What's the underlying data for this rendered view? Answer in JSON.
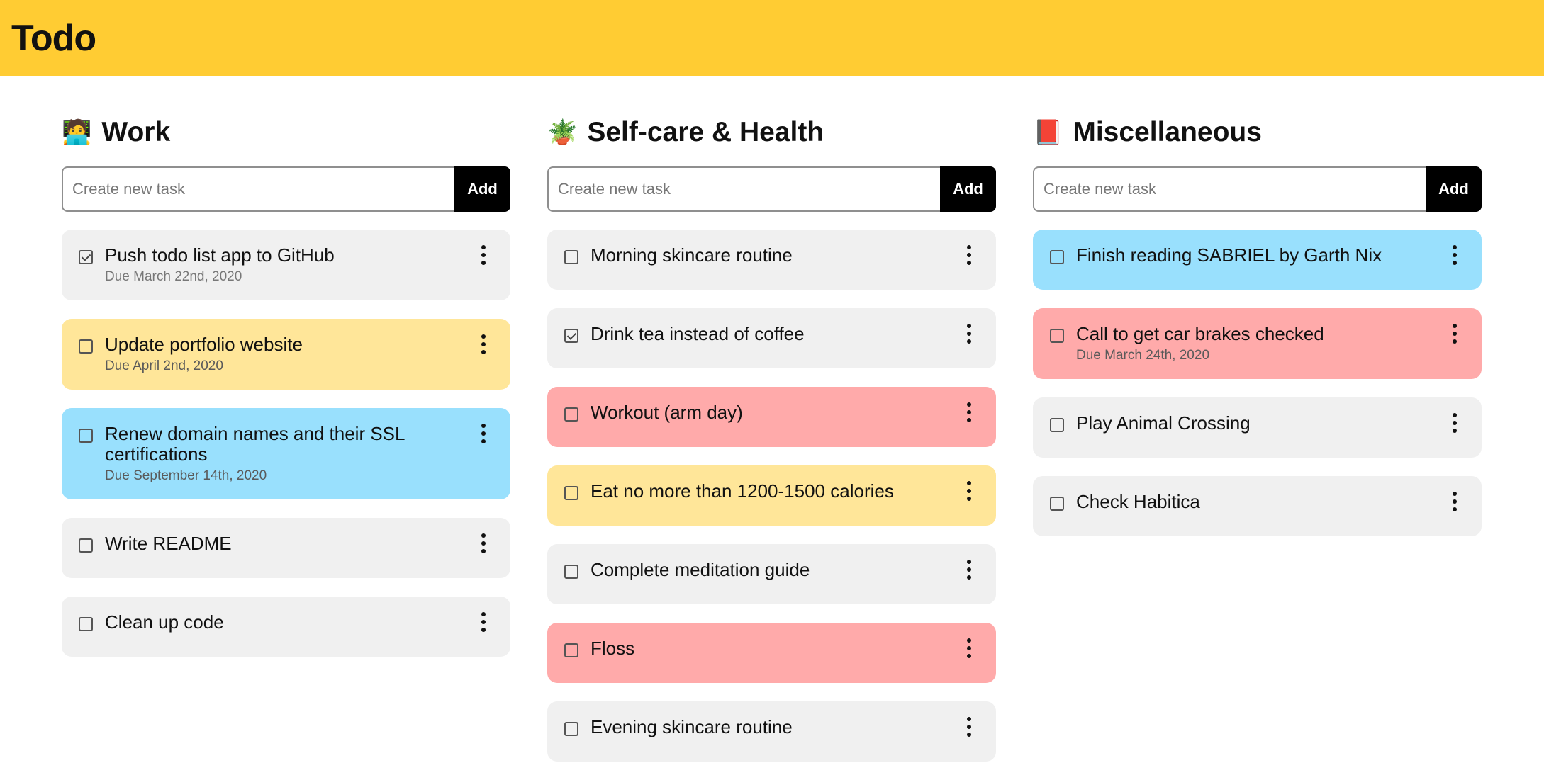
{
  "app": {
    "title": "Todo"
  },
  "columns": [
    {
      "emoji": "🧑‍💻",
      "title": "Work",
      "placeholder": "Create new task",
      "add_label": "Add",
      "tasks": [
        {
          "title": "Push todo list app to GitHub",
          "due": "Due March 22nd, 2020",
          "checked": true,
          "color": "grey"
        },
        {
          "title": "Update portfolio website",
          "due": "Due April 2nd, 2020",
          "checked": false,
          "color": "yellow"
        },
        {
          "title": "Renew domain names and their SSL certifications",
          "due": "Due September 14th, 2020",
          "checked": false,
          "color": "blue"
        },
        {
          "title": "Write README",
          "due": "",
          "checked": false,
          "color": "grey"
        },
        {
          "title": "Clean up code",
          "due": "",
          "checked": false,
          "color": "grey"
        }
      ]
    },
    {
      "emoji": "🪴",
      "title": "Self-care & Health",
      "placeholder": "Create new task",
      "add_label": "Add",
      "tasks": [
        {
          "title": "Morning skincare routine",
          "due": "",
          "checked": false,
          "color": "grey"
        },
        {
          "title": "Drink tea instead of coffee",
          "due": "",
          "checked": true,
          "color": "grey"
        },
        {
          "title": "Workout (arm day)",
          "due": "",
          "checked": false,
          "color": "red"
        },
        {
          "title": "Eat no more than 1200-1500 calories",
          "due": "",
          "checked": false,
          "color": "yellow"
        },
        {
          "title": "Complete meditation guide",
          "due": "",
          "checked": false,
          "color": "grey"
        },
        {
          "title": "Floss",
          "due": "",
          "checked": false,
          "color": "red"
        },
        {
          "title": "Evening skincare routine",
          "due": "",
          "checked": false,
          "color": "grey"
        }
      ]
    },
    {
      "emoji": "📕",
      "title": "Miscellaneous",
      "placeholder": "Create new task",
      "add_label": "Add",
      "tasks": [
        {
          "title": "Finish reading SABRIEL by Garth Nix",
          "due": "",
          "checked": false,
          "color": "blue"
        },
        {
          "title": "Call to get car brakes checked",
          "due": "Due March 24th, 2020",
          "checked": false,
          "color": "red"
        },
        {
          "title": "Play Animal Crossing",
          "due": "",
          "checked": false,
          "color": "grey"
        },
        {
          "title": "Check Habitica",
          "due": "",
          "checked": false,
          "color": "grey"
        }
      ]
    }
  ],
  "colors": {
    "header": "#ffcc33",
    "grey": "#f0f0f0",
    "yellow": "#ffe699",
    "blue": "#99e0fd",
    "red": "#ffaaaa",
    "button": "#000000"
  }
}
